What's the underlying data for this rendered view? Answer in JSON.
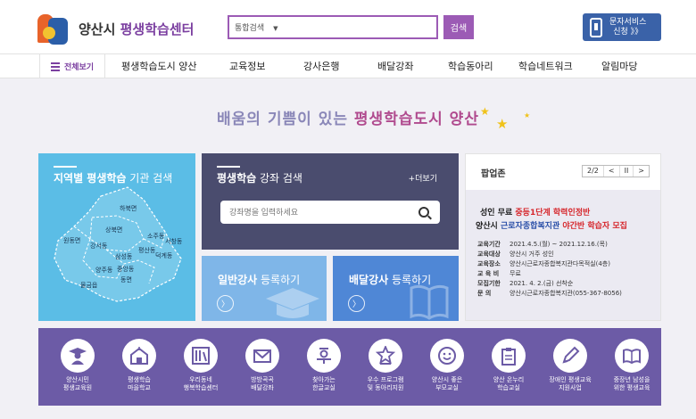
{
  "header": {
    "logo_seal_text": "양산시 평생 학습",
    "logo_prefix": "양산시 ",
    "logo_accent": "평생학습센터",
    "search_category": "통합검색",
    "search_button": "검색",
    "sms_line1": "문자서비스",
    "sms_line2": "신청 》》"
  },
  "nav": {
    "all_menu": "전체보기",
    "items": [
      "평생학습도시 양산",
      "교육정보",
      "강사은행",
      "배달강좌",
      "학습동아리",
      "학습네트워크",
      "알림마당"
    ]
  },
  "slogan": {
    "part1": "배움의 기쁨이 있는 ",
    "part2": "평생학습도시 양산"
  },
  "region": {
    "title_bold": "지역별 평생학습",
    "title_light": " 기관 검색",
    "districts": [
      "하북면",
      "상북면",
      "원동면",
      "강서동",
      "소주동",
      "서창동",
      "평산동",
      "덕계동",
      "삼성동",
      "중앙동",
      "양주동",
      "동면",
      "물금읍"
    ]
  },
  "lecture": {
    "title_bold": "평생학습",
    "title_light": " 강좌 검색",
    "more": "+더보기",
    "placeholder": "강좌명을 입력하세요"
  },
  "register": {
    "general_bold": "일반강사",
    "general_light": " 등록하기",
    "delivery_bold": "배달강사",
    "delivery_light": " 등록하기",
    "arrow": "〉"
  },
  "popup": {
    "title": "팝업존",
    "pager": "2/2",
    "prev": "<",
    "pause": "II",
    "next": ">",
    "headline1_a": "성인 무료 ",
    "headline1_b": "중등1단계 학력인정반",
    "headline2_a": "양산시 ",
    "headline2_b": "근로자종합복지관",
    "headline2_c": " 야간반 학습자 모집",
    "rows": [
      {
        "k": "교육기간",
        "v": "2021.4.5.(월) ~ 2021.12.16.(목)"
      },
      {
        "k": "교육대상",
        "v": "양산시 거주 성인"
      },
      {
        "k": "교육장소",
        "v": "양산시근로자종합복지관다목적실(4층)"
      },
      {
        "k": "교 육 비",
        "v": "무료"
      },
      {
        "k": "모집기한",
        "v": "2021. 4. 2.(금) 선착순"
      },
      {
        "k": "문    의",
        "v": "양산시근로자종합복지관(055-367-8056)"
      }
    ]
  },
  "services": [
    {
      "line1": "양산시민",
      "line2": "평생교육원",
      "icon": "graduate-icon"
    },
    {
      "line1": "평생학습",
      "line2": "마을학교",
      "icon": "school-icon"
    },
    {
      "line1": "우리동네",
      "line2": "행복학습센터",
      "icon": "bookshelf-icon"
    },
    {
      "line1": "방방곡곡",
      "line2": "배달강좌",
      "icon": "mail-icon"
    },
    {
      "line1": "찾아가는",
      "line2": "한글교실",
      "icon": "hangul-icon"
    },
    {
      "line1": "우수 프로그램",
      "line2": "및 동아리지원",
      "icon": "star-badge-icon"
    },
    {
      "line1": "양산시 좋은",
      "line2": "부모교실",
      "icon": "parent-icon"
    },
    {
      "line1": "양산 온누리",
      "line2": "학습교실",
      "icon": "clipboard-icon"
    },
    {
      "line1": "장애인 평생교육",
      "line2": "지원사업",
      "icon": "pen-icon"
    },
    {
      "line1": "중장년 남성을",
      "line2": "위한 평생교육",
      "icon": "book-icon"
    }
  ],
  "colors": {
    "brand_purple": "#9c5bb5",
    "region_blue": "#5bbde6",
    "lecture_navy": "#4a4c6e",
    "band_purple": "#6c5ba6",
    "accent_red": "#d6262b"
  }
}
